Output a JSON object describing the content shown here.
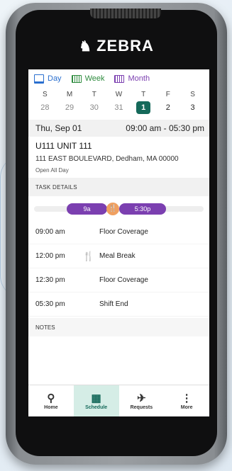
{
  "brand": {
    "name": "ZEBRA",
    "mark": "♞"
  },
  "views": [
    {
      "label": "Day",
      "color": "#2a6fcf"
    },
    {
      "label": "Week",
      "color": "#2e8b3e"
    },
    {
      "label": "Month",
      "color": "#7b3fb0"
    }
  ],
  "week": {
    "days": [
      "S",
      "M",
      "T",
      "W",
      "T",
      "F",
      "S"
    ],
    "dates": [
      "28",
      "29",
      "30",
      "31",
      "1",
      "2",
      "3"
    ],
    "selected_index": 4
  },
  "day_header": {
    "date": "Thu, Sep 01",
    "hours": "09:00 am - 05:30 pm"
  },
  "location": {
    "unit": "U111  UNIT 111",
    "address": "111 EAST BOULEVARD, Dedham, MA 00000",
    "open": "Open All Day"
  },
  "task_details_label": "TASK DETAILS",
  "timeline": {
    "start_label": "9a",
    "end_label": "5:30p",
    "meal_icon": "fork-knife-icon",
    "color": "#7b3fb0",
    "meal_color": "#f0a060"
  },
  "tasks": [
    {
      "time": "09:00 am",
      "icon": "",
      "label": "Floor Coverage"
    },
    {
      "time": "12:00 pm",
      "icon": "fork-knife-icon",
      "label": "Meal Break"
    },
    {
      "time": "12:30 pm",
      "icon": "",
      "label": "Floor Coverage"
    },
    {
      "time": "05:30 pm",
      "icon": "",
      "label": "Shift End"
    }
  ],
  "notes_label": "NOTES",
  "nav": [
    {
      "label": "Home",
      "icon": "person-icon"
    },
    {
      "label": "Schedule",
      "icon": "calendar-icon",
      "active": true
    },
    {
      "label": "Requests",
      "icon": "airplane-icon"
    },
    {
      "label": "More",
      "icon": "more-vertical-icon"
    }
  ],
  "accent_color": "#15695a"
}
